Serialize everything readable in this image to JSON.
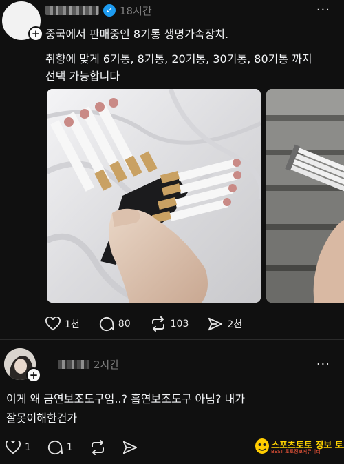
{
  "post": {
    "time": "18시간",
    "text_line1": "중국에서 판매중인 8기통 생명가속장치.",
    "text_line2": "취향에 맞게 6기통, 8기통, 20기통, 30기통, 80기통 까지",
    "text_line3": "선택 가능합니다",
    "actions": {
      "likes": "1천",
      "comments": "80",
      "reposts": "103",
      "shares": "2천"
    }
  },
  "reply": {
    "time": "2시간",
    "text_line1": "이게 왜 금연보조도구임..? 흡연보조도구 아님? 내가",
    "text_line2": "잘못이해한건가",
    "actions": {
      "likes": "1",
      "comments": "1"
    }
  },
  "watermark": {
    "text": "스포츠토토 정보 토토군",
    "subtext": "BEST 토토정보커뮤니티"
  },
  "colors": {
    "background": "#101010",
    "text": "#f3f5f7",
    "muted": "#7f7f7f",
    "verified": "#1d9bf0"
  }
}
